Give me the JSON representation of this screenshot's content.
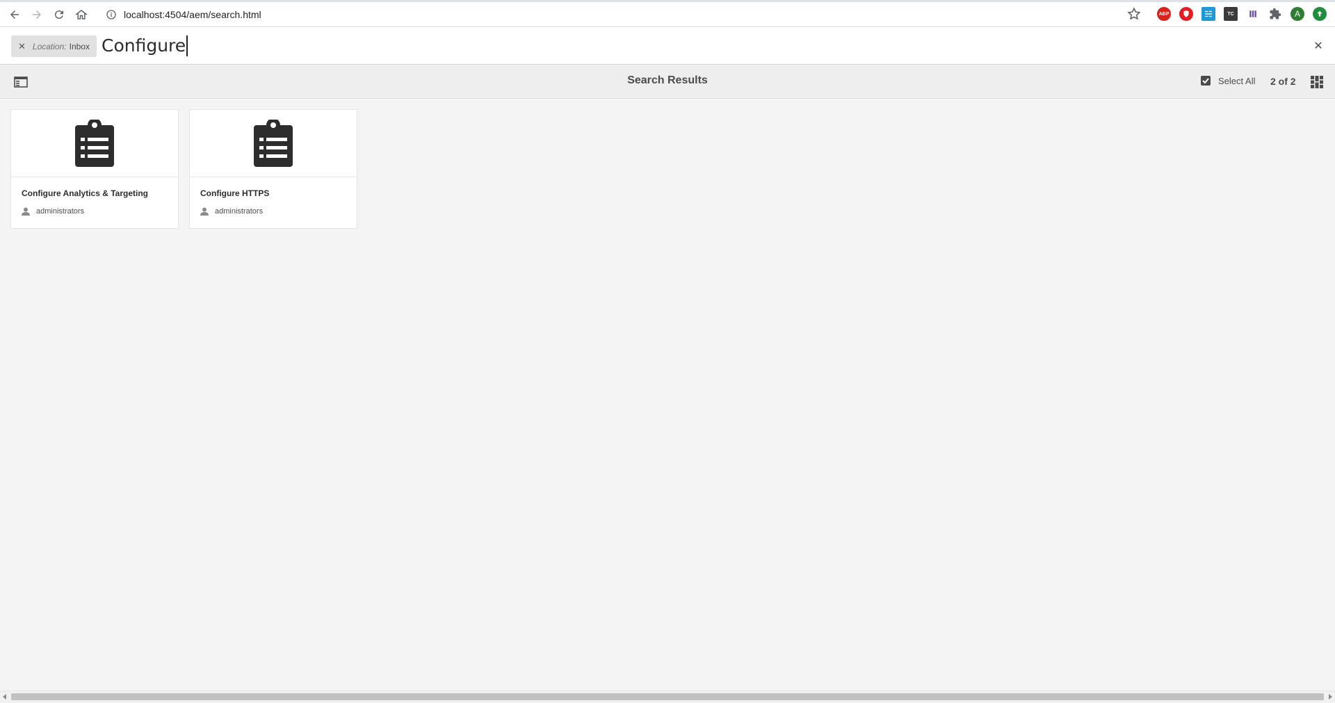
{
  "browser": {
    "url": "localhost:4504/aem/search.html",
    "profile_initial": "A",
    "extensions": [
      {
        "name": "adblock-icon",
        "label": "ABP",
        "color": "#d9221c"
      },
      {
        "name": "opera-style-icon",
        "label": "",
        "color": "#e31f26"
      },
      {
        "name": "translate-icon",
        "label": "",
        "color": "#1c9ad6"
      },
      {
        "name": "tc-icon",
        "label": "TC",
        "color": "#3a3a3a"
      },
      {
        "name": "hive-icon",
        "label": "",
        "color": "#6b4fa0"
      },
      {
        "name": "puzzle-icon",
        "label": "",
        "color": "#5f6368"
      },
      {
        "name": "green-arrow-icon",
        "label": "",
        "color": "#1e8e3e"
      }
    ]
  },
  "search": {
    "tag_key": "Location:",
    "tag_value": "Inbox",
    "query": "Configure"
  },
  "actionbar": {
    "title": "Search Results",
    "select_all": "Select All",
    "count": "2 of 2"
  },
  "results": [
    {
      "title": "Configure Analytics & Targeting",
      "assignee": "administrators"
    },
    {
      "title": "Configure HTTPS",
      "assignee": "administrators"
    }
  ]
}
